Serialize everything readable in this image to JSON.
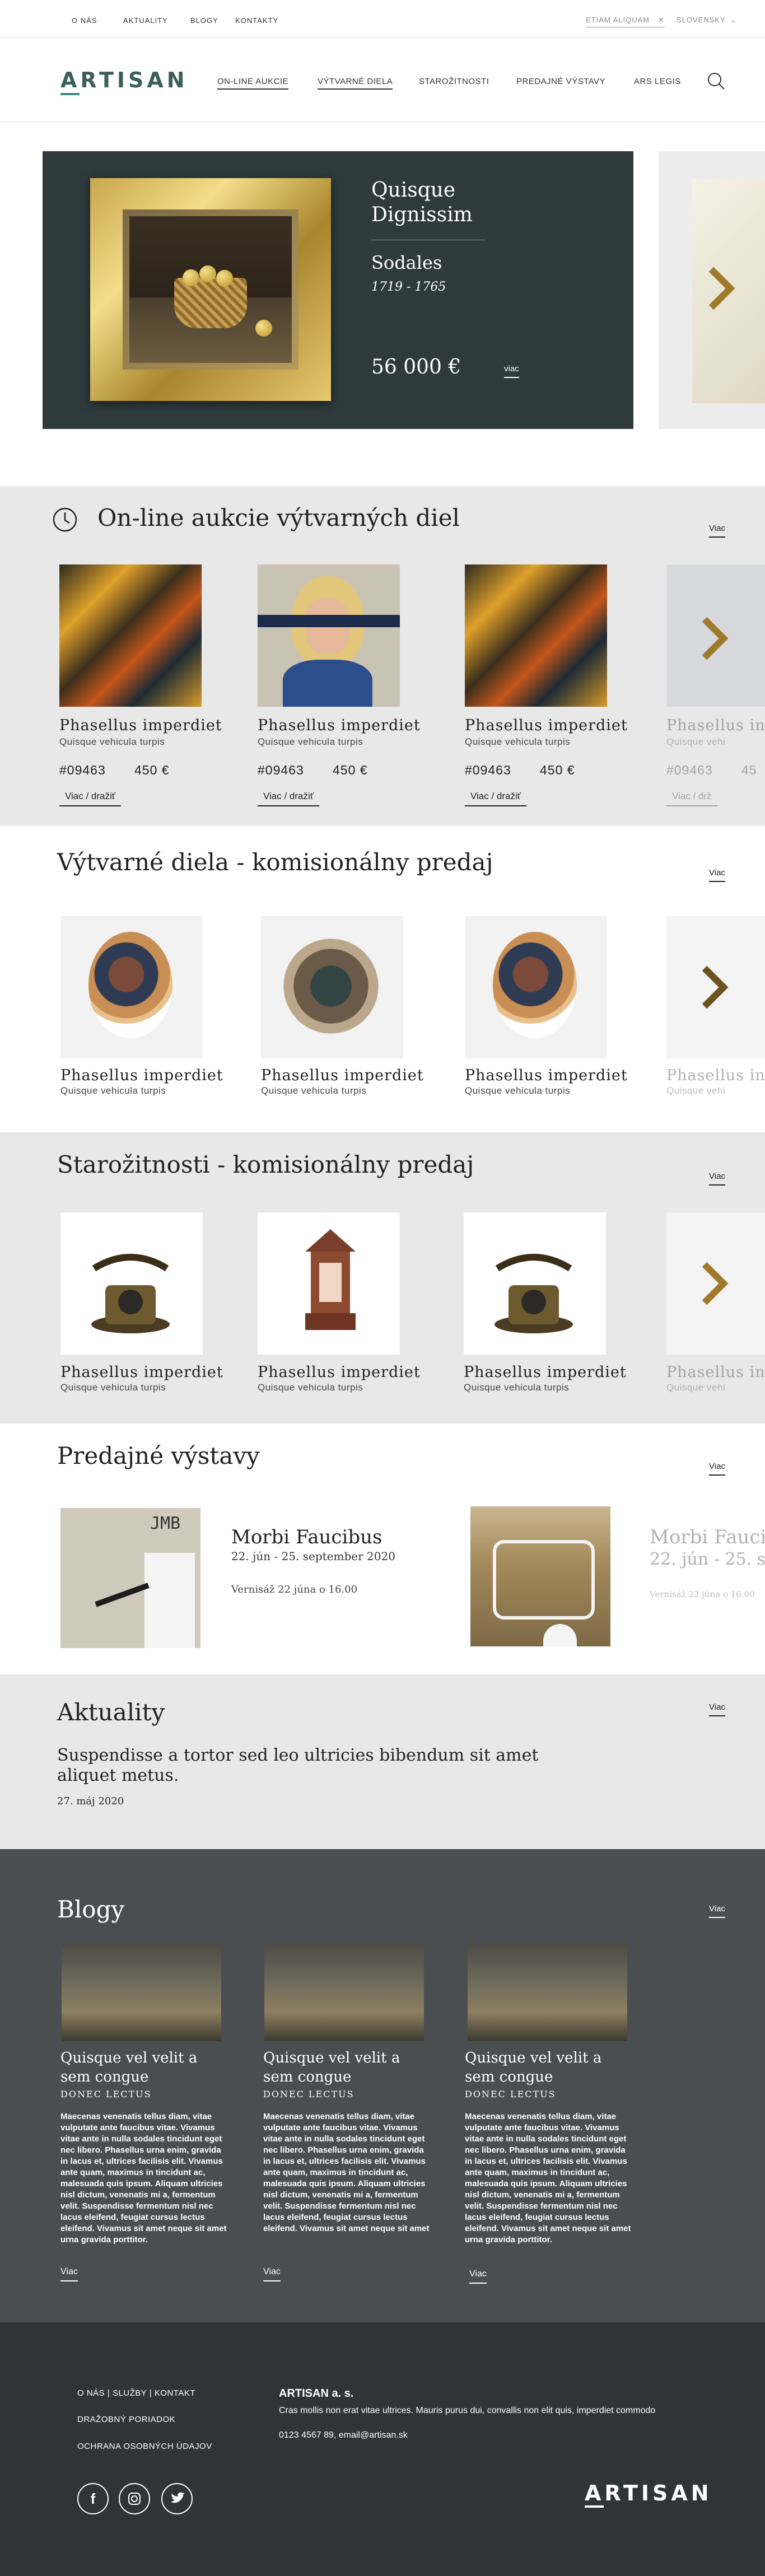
{
  "topbar": {
    "links": [
      "O NÁS",
      "AKTUALITY",
      "BLOGY",
      "KONTAKTY"
    ],
    "search_value": "ETIAM ALIQUAM",
    "language": "SLOVENSKY"
  },
  "header": {
    "logo": "ARTISAN",
    "nav": [
      "ON-LINE AUKCIE",
      "VÝTVARNÉ DIELA",
      "STAROŽITNOSTI",
      "PREDAJNÉ VÝSTAVY",
      "ARS LEGIS"
    ]
  },
  "hero": {
    "author": "Quisque Dignissim",
    "title": "Sodales",
    "years": "1719 - 1765",
    "price": "56 000 €",
    "more": "viac"
  },
  "auctions": {
    "title": "On-line aukcie výtvarných diel",
    "more": "Viac",
    "items": [
      {
        "title": "Phasellus imperdiet",
        "subtitle": "Quisque vehicula turpis",
        "code": "#09463",
        "price": "450 €",
        "action": "Viac / dražiť"
      },
      {
        "title": "Phasellus imperdiet",
        "subtitle": "Quisque vehicula turpis",
        "code": "#09463",
        "price": "450 €",
        "action": "Viac / dražiť"
      },
      {
        "title": "Phasellus imperdiet",
        "subtitle": "Quisque vehicula turpis",
        "code": "#09463",
        "price": "450 €",
        "action": "Viac / dražiť"
      },
      {
        "title": "Phasellus in",
        "subtitle": "Quisque vehi",
        "code": "#09463",
        "price": "45",
        "action": "Viac / drž"
      }
    ]
  },
  "artworks": {
    "title": "Výtvarné diela - komisionálny predaj",
    "more": "Viac",
    "items": [
      {
        "title": "Phasellus imperdiet",
        "subtitle": "Quisque vehicula turpis"
      },
      {
        "title": "Phasellus imperdiet",
        "subtitle": "Quisque vehicula turpis"
      },
      {
        "title": "Phasellus imperdiet",
        "subtitle": "Quisque vehicula turpis"
      },
      {
        "title": "Phasellus in",
        "subtitle": "Quisque vehi"
      }
    ]
  },
  "antiques": {
    "title": "Starožitnosti - komisionálny predaj",
    "more": "Viac",
    "items": [
      {
        "title": "Phasellus imperdiet",
        "subtitle": "Quisque vehicula turpis"
      },
      {
        "title": "Phasellus imperdiet",
        "subtitle": "Quisque vehicula turpis"
      },
      {
        "title": "Phasellus imperdiet",
        "subtitle": "Quisque vehicula turpis"
      },
      {
        "title": "Phasellus in",
        "subtitle": "Quisque vehi"
      }
    ]
  },
  "exhibitions": {
    "title": "Predajné výstavy",
    "more": "Viac",
    "img1_text": "JMB",
    "items": [
      {
        "title": "Morbi Faucibus",
        "date": "22. jún - 25. september 2020",
        "vernisage": "Vernisáž 22 júna o 16.00"
      },
      {
        "title": "Morbi Faucib",
        "date": "22. jún - 25. se",
        "vernisage": "Vernisáž 22 júna o 16.00"
      }
    ]
  },
  "news": {
    "title": "Aktuality",
    "more": "Viac",
    "headline": "Suspendisse a tortor sed leo ultricies bibendum sit amet aliquet metus.",
    "date": "27. máj 2020"
  },
  "blogs": {
    "title": "Blogy",
    "more": "Viac",
    "items": [
      {
        "title": "Quisque vel velit a sem congue",
        "author": "DONEC LECTUS",
        "text": "Maecenas venenatis tellus diam, vitae vulputate ante faucibus vitae. Vivamus vitae ante in nulla sodales tincidunt eget nec libero. Phasellus urna enim, gravida in lacus et, ultrices facilisis elit. Vivamus ante quam, maximus in tincidunt ac, malesuada quis ipsum. Aliquam ultricies nisl dictum, venenatis mi a, fermentum velit. Suspendisse fermentum nisl nec lacus eleifend, feugiat cursus lectus eleifend. Vivamus sit amet neque sit amet urna gravida porttitor.",
        "more": "Viac"
      },
      {
        "title": "Quisque vel velit a sem congue",
        "author": "DONEC LECTUS",
        "text": "Maecenas venenatis tellus diam, vitae vulputate ante faucibus vitae. Vivamus vitae ante in nulla sodales tincidunt eget nec libero. Phasellus urna enim, gravida in lacus et, ultrices facilisis elit. Vivamus ante quam, maximus in tincidunt ac, malesuada quis ipsum. Aliquam ultricies nisl dictum, venenatis mi a, fermentum velit. Suspendisse fermentum nisl nec lacus eleifend, feugiat cursus lectus eleifend. Vivamus sit amet neque sit amet",
        "more": "Viac"
      },
      {
        "title": "Quisque vel velit a sem congue",
        "author": "DONEC LECTUS",
        "text": "Maecenas venenatis tellus diam, vitae vulputate ante faucibus vitae. Vivamus vitae ante in nulla sodales tincidunt eget nec libero. Phasellus urna enim, gravida in lacus et, ultrices facilisis elit. Vivamus ante quam, maximus in tincidunt ac, malesuada quis ipsum. Aliquam ultricies nisl dictum, venenatis mi a, fermentum velit. Suspendisse fermentum nisl nec lacus eleifend, feugiat cursus lectus eleifend. Vivamus sit amet neque sit amet urna gravida porttitor.",
        "more": "Viac"
      }
    ]
  },
  "footer": {
    "links_row": [
      "O NÁS",
      "SLUŽBY",
      "KONTAKT"
    ],
    "link2": "DRAŽOBNÝ PORIADOK",
    "link3": "OCHRANA OSOBNÝCH ÚDAJOV",
    "company": "ARTISAN a. s.",
    "address": "Cras mollis non erat vitae ultrices. Mauris purus dui, convallis non elit quis, imperdiet commodo",
    "contact": "0123 4567 89, email@artisan.sk",
    "logo": "ARTISAN"
  },
  "colors": {
    "accent": "#3c8a7e",
    "hero_bg": "#2e3a3c",
    "blog_bg": "#4a4e50",
    "footer_bg": "#2f3537",
    "chevron": "#a07a2b"
  }
}
